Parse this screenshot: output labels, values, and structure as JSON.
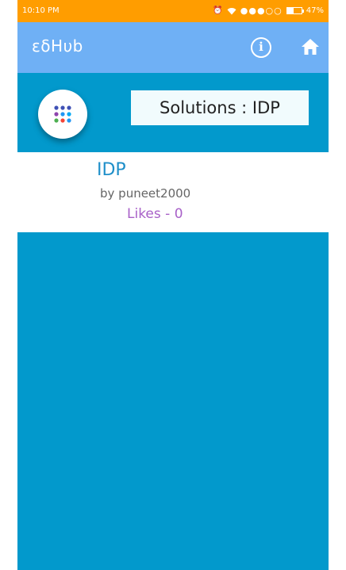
{
  "status_bar": {
    "time": "10:10 PM",
    "signal": "●●●○○",
    "battery": "47%"
  },
  "app_bar": {
    "title": "εδHυb",
    "info_icon": "info-circle-icon",
    "home_icon": "home-icon"
  },
  "header": {
    "menu_icon": "grid-dots-icon",
    "title": "Solutions : IDP"
  },
  "solution": {
    "name": "IDP",
    "author": "by puneet2000",
    "likes": "Likes - 0"
  },
  "colors": {
    "status_bar": "#ff9d00",
    "app_bar": "#6fb0f5",
    "background": "#0299cc",
    "title_text": "#1f8fc9",
    "likes_text": "#a861c8"
  }
}
